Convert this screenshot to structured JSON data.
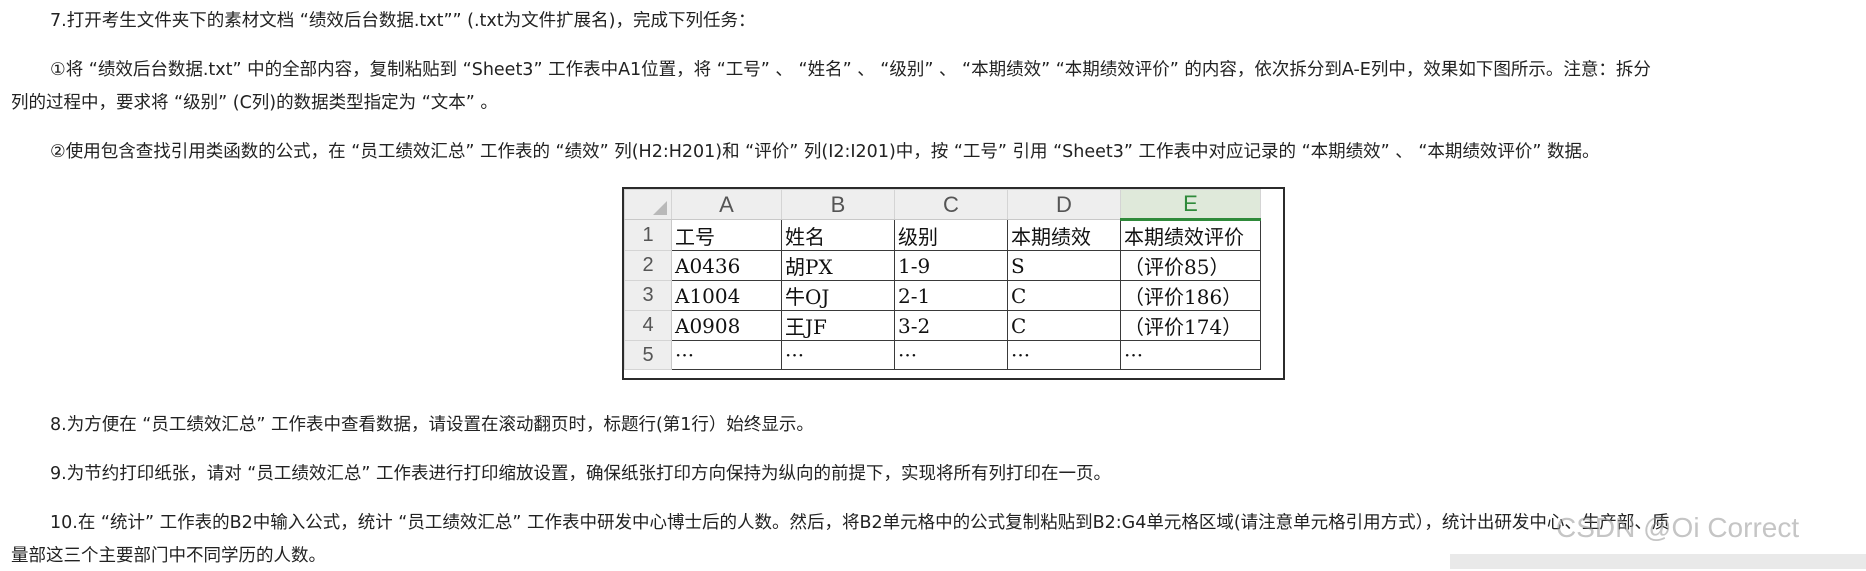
{
  "paragraphs": {
    "p7": "7.打开考生文件夹下的素材文档 “绩效后台数据.txt”” (.txt为文件扩展名)，完成下列任务：",
    "p7_sub1_line1": "①将 “绩效后台数据.txt” 中的全部内容，复制粘贴到 “Sheet3” 工作表中A1位置，将 “工号” 、 “姓名” 、 “级别” 、 “本期绩效” “本期绩效评价” 的内容，依次拆分到A-E列中，效果如下图所示。注意：拆分",
    "p7_sub1_line2": "列的过程中，要求将 “级别” (C列)的数据类型指定为 “文本” 。",
    "p7_sub2": "②使用包含查找引用类函数的公式，在 “员工绩效汇总” 工作表的 “绩效” 列(H2:H201)和 “评价” 列(I2:I201)中，按 “工号” 引用 “Sheet3” 工作表中对应记录的 “本期绩效” 、 “本期绩效评价” 数据。",
    "p8": "8.为方便在 “员工绩效汇总” 工作表中查看数据，请设置在滚动翻页时，标题行(第1行）始终显示。",
    "p9": "9.为节约打印纸张，请对 “员工绩效汇总” 工作表进行打印缩放设置，确保纸张打印方向保持为纵向的前提下，实现将所有列打印在一页。",
    "p10_line1": "10.在 “统计” 工作表的B2中输入公式，统计 “员工绩效汇总” 工作表中研发中心博士后的人数。然后，将B2单元格中的公式复制粘贴到B2:G4单元格区域(请注意单元格引用方式），统计出研发中心、生产部、质",
    "p10_line2": "量部这三个主要部门中不同学历的人数。"
  },
  "sheet": {
    "columns": [
      "A",
      "B",
      "C",
      "D",
      "E"
    ],
    "selected_column": "E",
    "row_numbers": [
      "1",
      "2",
      "3",
      "4",
      "5"
    ],
    "rows": [
      [
        "工号",
        "姓名",
        "级别",
        "本期绩效",
        "本期绩效评价"
      ],
      [
        "A0436",
        "胡PX",
        "1-9",
        "S",
        "（评价85）"
      ],
      [
        "A1004",
        "牛OJ",
        "2-1",
        "C",
        "（评价186）"
      ],
      [
        "A0908",
        "王JF",
        "3-2",
        "C",
        "（评价174）"
      ],
      [
        "···",
        "···",
        "···",
        "···",
        "···"
      ]
    ]
  },
  "watermark": "CSDN @Oi Correct",
  "colors": {
    "selected_header": "#2f8a3a",
    "header_bg": "#eeeeee"
  }
}
